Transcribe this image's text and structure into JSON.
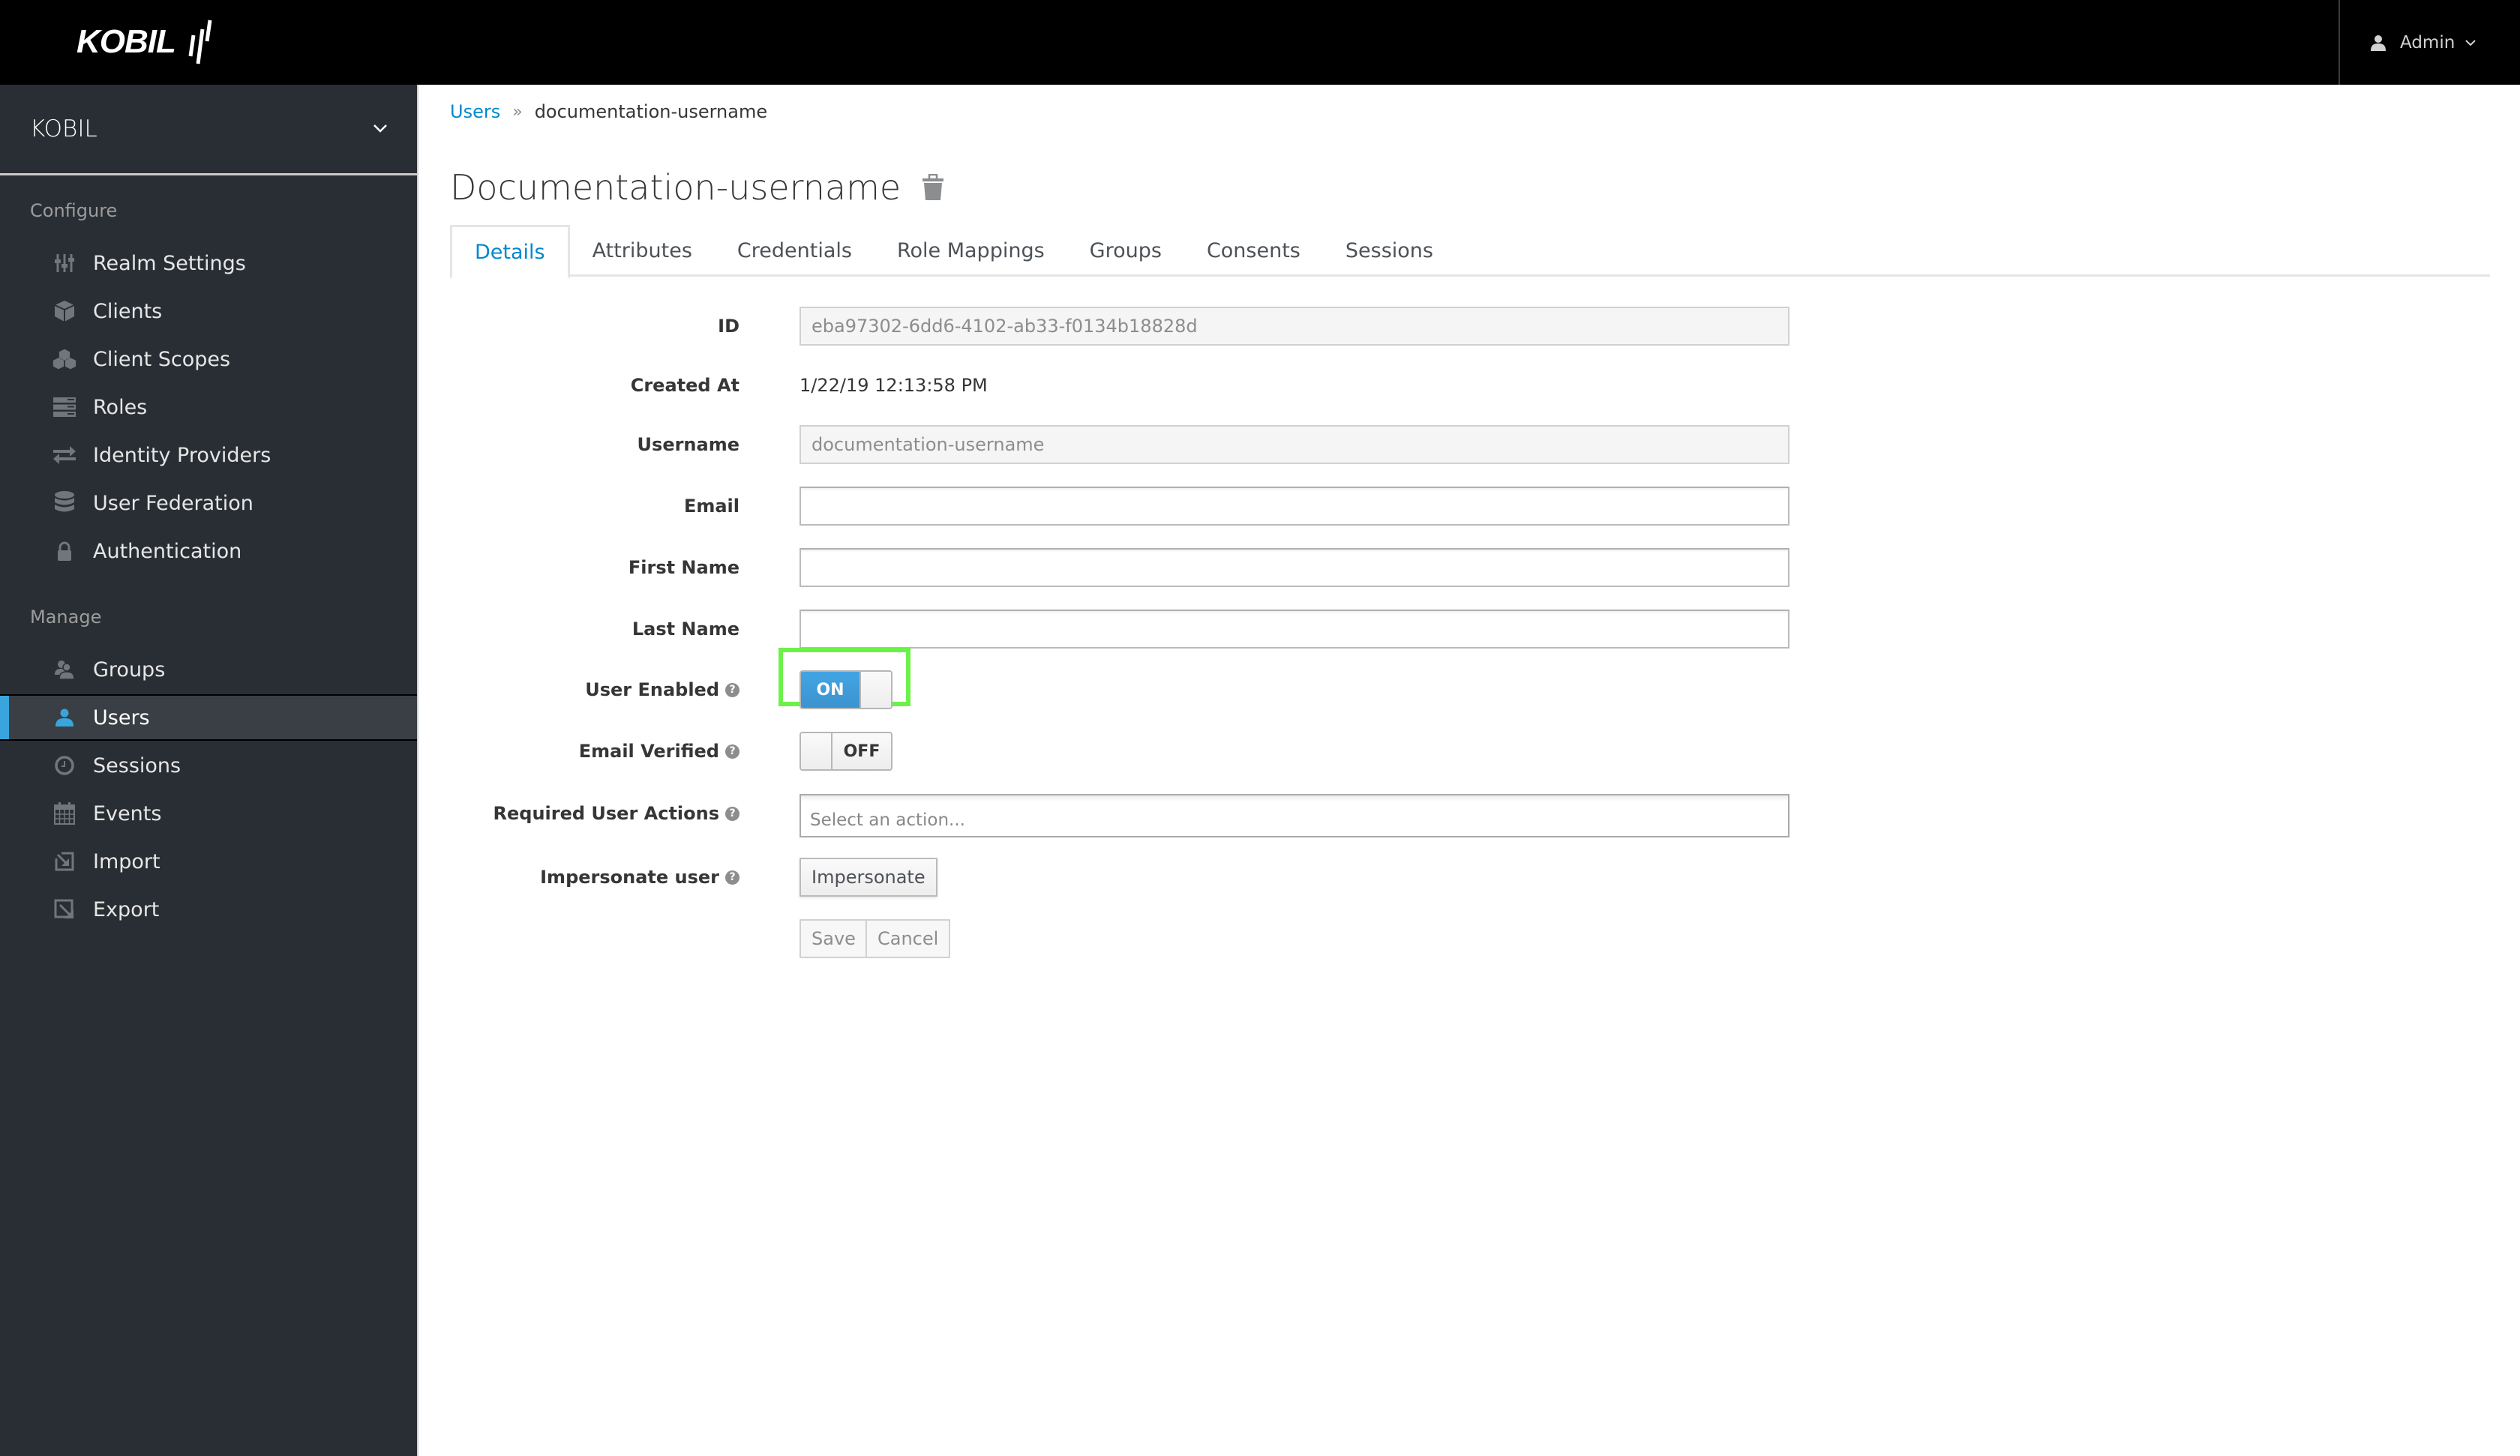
{
  "header": {
    "brand": "KOBIL",
    "user_label": "Admin"
  },
  "sidebar": {
    "realm": "KOBIL",
    "configure_label": "Configure",
    "configure_items": [
      {
        "label": "Realm Settings",
        "icon": "sliders-icon"
      },
      {
        "label": "Clients",
        "icon": "cube-icon"
      },
      {
        "label": "Client Scopes",
        "icon": "cubes-icon"
      },
      {
        "label": "Roles",
        "icon": "server-icon"
      },
      {
        "label": "Identity Providers",
        "icon": "exchange-icon"
      },
      {
        "label": "User Federation",
        "icon": "database-icon"
      },
      {
        "label": "Authentication",
        "icon": "lock-icon"
      }
    ],
    "manage_label": "Manage",
    "manage_items": [
      {
        "label": "Groups",
        "icon": "users-icon"
      },
      {
        "label": "Users",
        "icon": "user-icon",
        "active": true
      },
      {
        "label": "Sessions",
        "icon": "clock-icon"
      },
      {
        "label": "Events",
        "icon": "calendar-icon"
      },
      {
        "label": "Import",
        "icon": "import-icon"
      },
      {
        "label": "Export",
        "icon": "export-icon"
      }
    ],
    "accent_color": "#39a5dc"
  },
  "breadcrumb": {
    "parent": "Users",
    "separator": "»",
    "current": "documentation-username"
  },
  "page": {
    "title": "Documentation-username"
  },
  "tabs": [
    {
      "label": "Details",
      "active": true
    },
    {
      "label": "Attributes"
    },
    {
      "label": "Credentials"
    },
    {
      "label": "Role Mappings"
    },
    {
      "label": "Groups"
    },
    {
      "label": "Consents"
    },
    {
      "label": "Sessions"
    }
  ],
  "form": {
    "id": {
      "label": "ID",
      "value": "eba97302-6dd6-4102-ab33-f0134b18828d"
    },
    "created_at": {
      "label": "Created At",
      "value": "1/22/19 12:13:58 PM"
    },
    "username": {
      "label": "Username",
      "value": "documentation-username"
    },
    "email": {
      "label": "Email",
      "value": ""
    },
    "first_name": {
      "label": "First Name",
      "value": ""
    },
    "last_name": {
      "label": "Last Name",
      "value": ""
    },
    "user_enabled": {
      "label": "User Enabled",
      "state": "ON"
    },
    "email_verified": {
      "label": "Email Verified",
      "state": "OFF"
    },
    "required_actions": {
      "label": "Required User Actions",
      "placeholder": "Select an action..."
    },
    "impersonate": {
      "label": "Impersonate user",
      "button": "Impersonate"
    },
    "save_label": "Save",
    "cancel_label": "Cancel",
    "help_glyph": "?"
  }
}
